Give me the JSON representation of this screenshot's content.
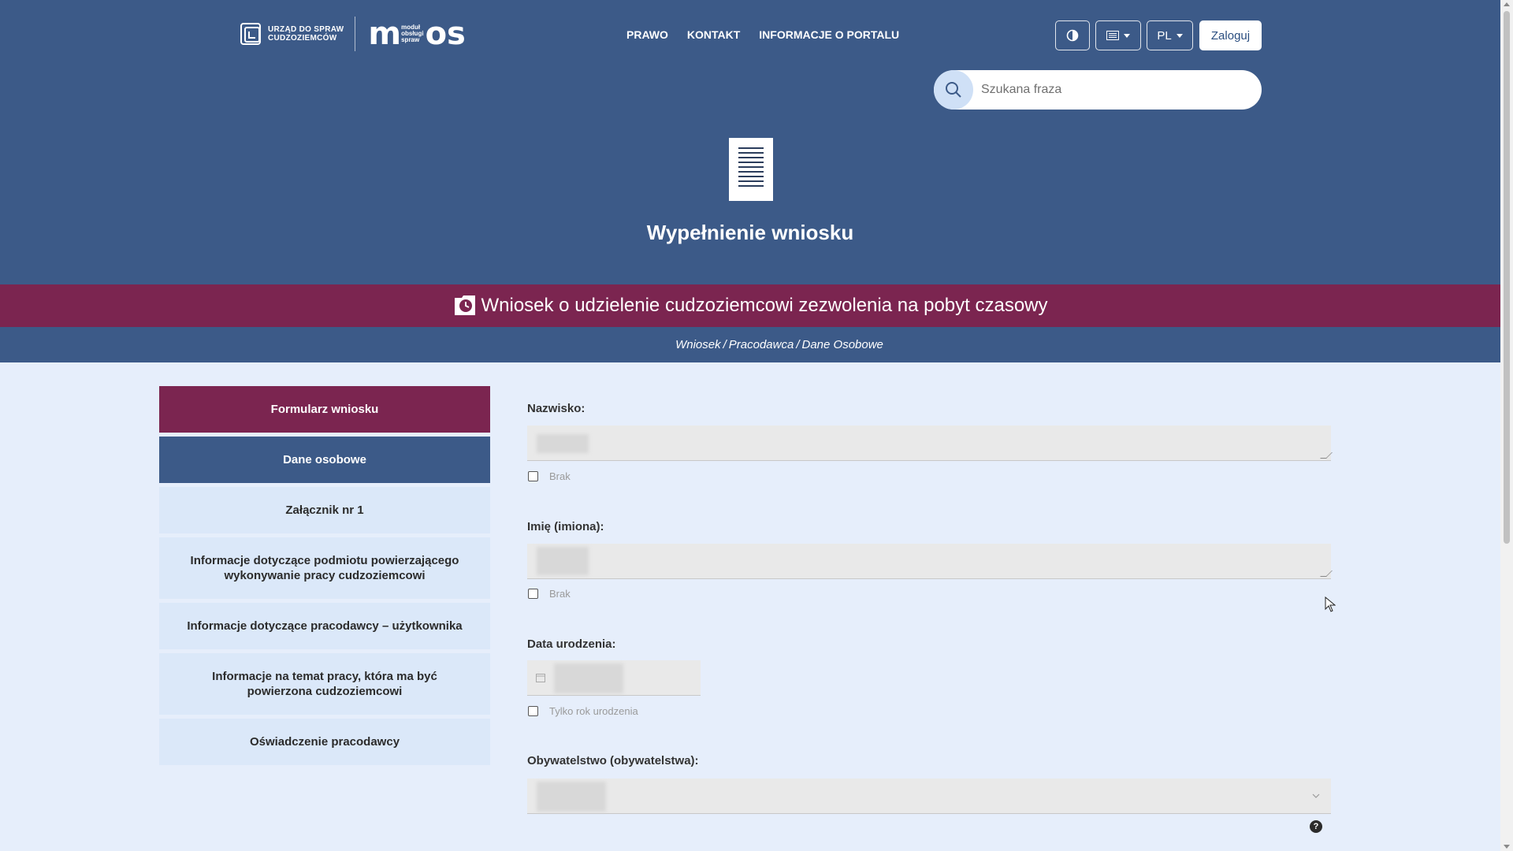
{
  "header": {
    "logo_udsc_line1": "URZĄD DO SPRAW",
    "logo_udsc_line2": "CUDZOZIEMCÓW",
    "logo_mos_small_1": "moduł",
    "logo_mos_small_2": "obsługi",
    "logo_mos_small_3": "spraw",
    "nav": [
      "PRAWO",
      "KONTAKT",
      "INFORMACJE O PORTALU"
    ],
    "lang_label": "PL",
    "login_label": "Zaloguj",
    "search_placeholder": "Szukana fraza",
    "page_title": "Wypełnienie wniosku"
  },
  "banner": {
    "title": "Wniosek o udzielenie cudzoziemcowi zezwolenia na pobyt czasowy"
  },
  "breadcrumb": [
    "Wniosek",
    "Pracodawca",
    "Dane Osobowe"
  ],
  "sidebar": {
    "items": [
      {
        "label": "Formularz wniosku",
        "state": "active"
      },
      {
        "label": "Dane osobowe",
        "state": "current"
      },
      {
        "label": "Załącznik nr 1",
        "state": "normal"
      },
      {
        "label": "Informacje dotyczące podmiotu powierzającego wykonywanie pracy cudzoziemcowi",
        "state": "normal"
      },
      {
        "label": "Informacje dotyczące pracodawcy – użytkownika",
        "state": "normal"
      },
      {
        "label": "Informacje na temat pracy, która ma być powierzona cudzoziemcowi",
        "state": "normal"
      },
      {
        "label": "Oświadczenie pracodawcy",
        "state": "normal"
      }
    ]
  },
  "form": {
    "surname_label": "Nazwisko:",
    "surname_none_label": "Brak",
    "firstname_label": "Imię (imiona):",
    "firstname_none_label": "Brak",
    "birthdate_label": "Data urodzenia:",
    "birthyear_only_label": "Tylko rok urodzenia",
    "citizenship_label": "Obywatelstwo (obywatelstwa):",
    "help_label": "?"
  },
  "colors": {
    "header_bg": "#3c5a88",
    "accent": "#7b2550",
    "page_bg": "#e6eefb"
  }
}
